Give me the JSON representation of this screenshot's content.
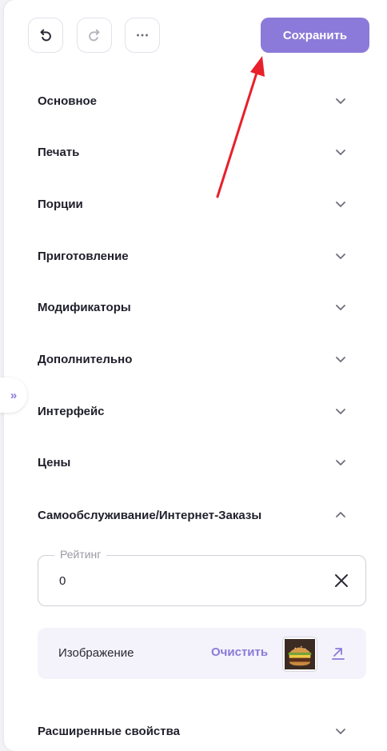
{
  "toolbar": {
    "undo_icon": "undo-icon",
    "redo_icon": "redo-icon",
    "more_icon": "more-icon",
    "save_label": "Сохранить",
    "accent_color": "#8b7ad9"
  },
  "sections": [
    {
      "label": "Основное",
      "expanded": false
    },
    {
      "label": "Печать",
      "expanded": false
    },
    {
      "label": "Порции",
      "expanded": false
    },
    {
      "label": "Приготовление",
      "expanded": false
    },
    {
      "label": "Модификаторы",
      "expanded": false
    },
    {
      "label": "Дополнительно",
      "expanded": false
    },
    {
      "label": "Интерфейс",
      "expanded": false
    },
    {
      "label": "Цены",
      "expanded": false
    },
    {
      "label": "Самообслуживание/Интернет-Заказы",
      "expanded": true
    },
    {
      "label": "Расширенные свойства",
      "expanded": false
    }
  ],
  "self_service": {
    "rating_label": "Рейтинг",
    "rating_value": "0",
    "image_label": "Изображение",
    "clear_label": "Очистить"
  },
  "side_tab_glyph": "»"
}
